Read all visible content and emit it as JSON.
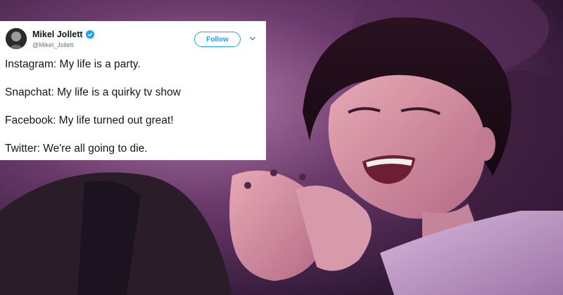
{
  "tweet": {
    "author_name": "Mikel Jollett",
    "author_handle": "@Mikel_Jollett",
    "follow_label": "Follow",
    "lines": [
      "Instagram: My life is a party.",
      "Snapchat: My life is a quirky tv show",
      "Facebook: My life turned out great!",
      "Twitter: We're all going to die."
    ]
  },
  "icons": {
    "verified": "verified-badge-icon",
    "menu": "chevron-down-icon"
  },
  "colors": {
    "twitter_blue": "#1da1f2",
    "text": "#14171a",
    "handle": "#657786",
    "background_tint": "#7a3a7e"
  }
}
